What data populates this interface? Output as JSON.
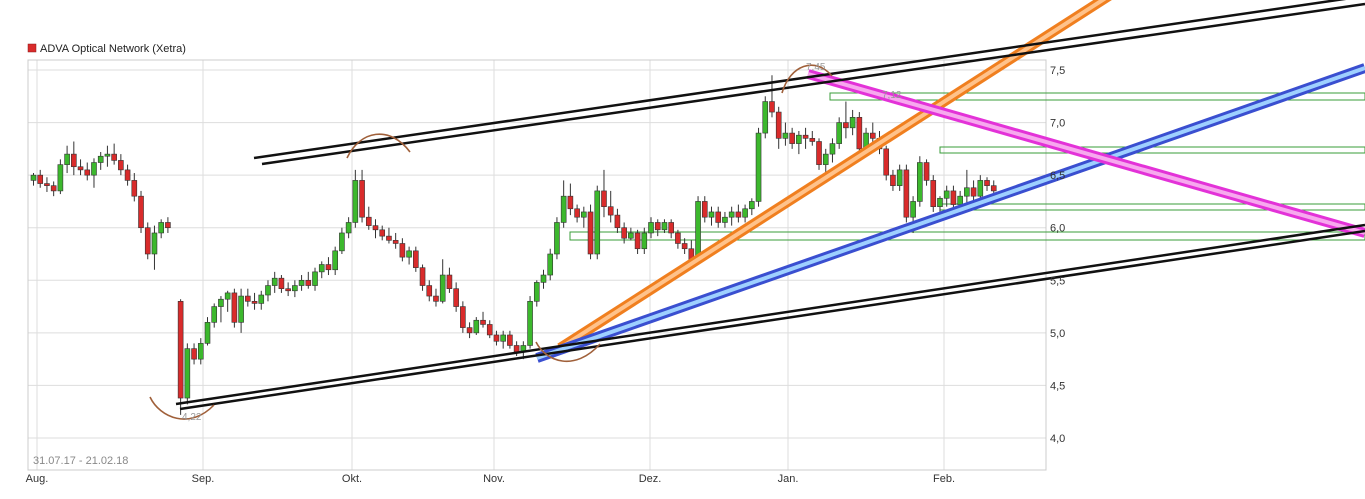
{
  "chart_data": {
    "type": "candlestick",
    "legend": {
      "label": "ADVA Optical Network (Xetra)",
      "color": "#d92b2b"
    },
    "date_range": "31.07.17 - 21.02.18",
    "y_ticks": [
      "4,0",
      "4,5",
      "5,0",
      "5,5",
      "6,0",
      "6,5",
      "7,0",
      "7,5"
    ],
    "x_ticks": [
      "Aug.",
      "Sep.",
      "Okt.",
      "Nov.",
      "Dez.",
      "Jan.",
      "Feb."
    ],
    "annotations": {
      "high": "7,45",
      "mid_high": "7,12",
      "low": "4,22"
    },
    "ylim": [
      3.8,
      7.7
    ],
    "grid": true,
    "legend_position": "top-left",
    "colors": {
      "up": "#3cb82d",
      "down": "#d92b2b",
      "grid": "#dddddd"
    },
    "candles": [
      [
        6.45,
        6.52,
        6.4,
        6.5
      ],
      [
        6.5,
        6.55,
        6.38,
        6.42
      ],
      [
        6.42,
        6.48,
        6.34,
        6.4
      ],
      [
        6.4,
        6.44,
        6.3,
        6.35
      ],
      [
        6.35,
        6.65,
        6.32,
        6.6
      ],
      [
        6.6,
        6.78,
        6.52,
        6.7
      ],
      [
        6.7,
        6.82,
        6.5,
        6.58
      ],
      [
        6.58,
        6.65,
        6.5,
        6.55
      ],
      [
        6.55,
        6.62,
        6.45,
        6.5
      ],
      [
        6.5,
        6.66,
        6.38,
        6.62
      ],
      [
        6.62,
        6.72,
        6.55,
        6.68
      ],
      [
        6.68,
        6.78,
        6.58,
        6.7
      ],
      [
        6.7,
        6.8,
        6.6,
        6.64
      ],
      [
        6.64,
        6.7,
        6.5,
        6.55
      ],
      [
        6.55,
        6.6,
        6.4,
        6.45
      ],
      [
        6.45,
        6.52,
        6.25,
        6.3
      ],
      [
        6.3,
        6.35,
        5.95,
        6.0
      ],
      [
        6.0,
        6.05,
        5.7,
        5.75
      ],
      [
        5.75,
        6.02,
        5.6,
        5.95
      ],
      [
        5.95,
        6.08,
        5.9,
        6.05
      ],
      [
        6.05,
        6.1,
        5.95,
        6.0
      ],
      [
        5.3,
        5.32,
        4.22,
        4.38
      ],
      [
        4.38,
        4.9,
        4.32,
        4.85
      ],
      [
        4.85,
        4.9,
        4.7,
        4.75
      ],
      [
        4.75,
        4.95,
        4.7,
        4.9
      ],
      [
        4.9,
        5.15,
        4.88,
        5.1
      ],
      [
        5.1,
        5.28,
        5.05,
        5.25
      ],
      [
        5.25,
        5.35,
        5.1,
        5.32
      ],
      [
        5.32,
        5.4,
        5.2,
        5.38
      ],
      [
        5.38,
        5.42,
        5.05,
        5.1
      ],
      [
        5.1,
        5.42,
        5.0,
        5.35
      ],
      [
        5.35,
        5.42,
        5.25,
        5.3
      ],
      [
        5.3,
        5.38,
        5.22,
        5.28
      ],
      [
        5.28,
        5.4,
        5.22,
        5.36
      ],
      [
        5.36,
        5.5,
        5.3,
        5.45
      ],
      [
        5.45,
        5.58,
        5.38,
        5.52
      ],
      [
        5.52,
        5.55,
        5.38,
        5.42
      ],
      [
        5.42,
        5.48,
        5.35,
        5.4
      ],
      [
        5.4,
        5.5,
        5.34,
        5.45
      ],
      [
        5.45,
        5.55,
        5.4,
        5.5
      ],
      [
        5.5,
        5.58,
        5.42,
        5.45
      ],
      [
        5.45,
        5.62,
        5.4,
        5.58
      ],
      [
        5.58,
        5.68,
        5.52,
        5.65
      ],
      [
        5.65,
        5.72,
        5.55,
        5.6
      ],
      [
        5.6,
        5.82,
        5.55,
        5.78
      ],
      [
        5.78,
        6.0,
        5.75,
        5.95
      ],
      [
        5.95,
        6.1,
        5.9,
        6.05
      ],
      [
        6.05,
        6.55,
        6.0,
        6.45
      ],
      [
        6.45,
        6.55,
        6.05,
        6.1
      ],
      [
        6.1,
        6.2,
        5.98,
        6.02
      ],
      [
        6.02,
        6.08,
        5.9,
        5.98
      ],
      [
        5.98,
        6.02,
        5.88,
        5.92
      ],
      [
        5.92,
        6.0,
        5.85,
        5.88
      ],
      [
        5.88,
        5.95,
        5.8,
        5.85
      ],
      [
        5.85,
        5.9,
        5.68,
        5.72
      ],
      [
        5.72,
        5.82,
        5.65,
        5.78
      ],
      [
        5.78,
        5.82,
        5.58,
        5.62
      ],
      [
        5.62,
        5.65,
        5.4,
        5.45
      ],
      [
        5.45,
        5.5,
        5.3,
        5.35
      ],
      [
        5.35,
        5.42,
        5.25,
        5.3
      ],
      [
        5.3,
        5.7,
        5.28,
        5.55
      ],
      [
        5.55,
        5.62,
        5.38,
        5.42
      ],
      [
        5.42,
        5.48,
        5.2,
        5.25
      ],
      [
        5.25,
        5.3,
        5.0,
        5.05
      ],
      [
        5.05,
        5.1,
        4.95,
        5.0
      ],
      [
        5.0,
        5.15,
        4.98,
        5.12
      ],
      [
        5.12,
        5.2,
        5.05,
        5.08
      ],
      [
        5.08,
        5.12,
        4.95,
        4.98
      ],
      [
        4.98,
        5.02,
        4.88,
        4.92
      ],
      [
        4.92,
        5.02,
        4.85,
        4.98
      ],
      [
        4.98,
        5.02,
        4.85,
        4.88
      ],
      [
        4.88,
        4.92,
        4.78,
        4.82
      ],
      [
        4.82,
        4.92,
        4.75,
        4.88
      ],
      [
        4.88,
        5.35,
        4.85,
        5.3
      ],
      [
        5.3,
        5.5,
        5.25,
        5.48
      ],
      [
        5.48,
        5.6,
        5.42,
        5.55
      ],
      [
        5.55,
        5.8,
        5.5,
        5.75
      ],
      [
        5.75,
        6.1,
        5.7,
        6.05
      ],
      [
        6.05,
        6.45,
        6.0,
        6.3
      ],
      [
        6.3,
        6.42,
        6.12,
        6.18
      ],
      [
        6.18,
        6.22,
        6.05,
        6.1
      ],
      [
        6.1,
        6.2,
        6.0,
        6.15
      ],
      [
        6.15,
        6.22,
        5.7,
        5.75
      ],
      [
        5.75,
        6.4,
        5.7,
        6.35
      ],
      [
        6.35,
        6.55,
        6.1,
        6.2
      ],
      [
        6.2,
        6.35,
        6.05,
        6.12
      ],
      [
        6.12,
        6.18,
        5.95,
        6.0
      ],
      [
        6.0,
        6.05,
        5.85,
        5.9
      ],
      [
        5.9,
        6.0,
        5.88,
        5.95
      ],
      [
        5.95,
        5.98,
        5.75,
        5.8
      ],
      [
        5.8,
        6.0,
        5.75,
        5.95
      ],
      [
        5.95,
        6.1,
        5.9,
        6.05
      ],
      [
        6.05,
        6.08,
        5.92,
        5.98
      ],
      [
        5.98,
        6.08,
        5.95,
        6.05
      ],
      [
        6.05,
        6.08,
        5.9,
        5.95
      ],
      [
        5.95,
        5.98,
        5.8,
        5.85
      ],
      [
        5.85,
        5.9,
        5.75,
        5.8
      ],
      [
        5.8,
        5.88,
        5.65,
        5.7
      ],
      [
        5.7,
        6.3,
        5.68,
        6.25
      ],
      [
        6.25,
        6.3,
        6.05,
        6.1
      ],
      [
        6.1,
        6.2,
        6.02,
        6.15
      ],
      [
        6.15,
        6.2,
        6.0,
        6.05
      ],
      [
        6.05,
        6.15,
        6.0,
        6.1
      ],
      [
        6.1,
        6.2,
        6.02,
        6.15
      ],
      [
        6.15,
        6.22,
        6.05,
        6.1
      ],
      [
        6.1,
        6.22,
        6.05,
        6.18
      ],
      [
        6.18,
        6.28,
        6.12,
        6.25
      ],
      [
        6.25,
        6.95,
        6.2,
        6.9
      ],
      [
        6.9,
        7.25,
        6.85,
        7.2
      ],
      [
        7.2,
        7.45,
        7.05,
        7.1
      ],
      [
        7.1,
        7.15,
        6.75,
        6.85
      ],
      [
        6.85,
        7.0,
        6.78,
        6.9
      ],
      [
        6.9,
        6.95,
        6.75,
        6.8
      ],
      [
        6.8,
        6.92,
        6.7,
        6.88
      ],
      [
        6.88,
        6.95,
        6.75,
        6.85
      ],
      [
        6.85,
        6.92,
        6.78,
        6.82
      ],
      [
        6.82,
        6.85,
        6.55,
        6.6
      ],
      [
        6.6,
        6.75,
        6.52,
        6.7
      ],
      [
        6.7,
        6.85,
        6.62,
        6.8
      ],
      [
        6.8,
        7.05,
        6.75,
        7.0
      ],
      [
        7.0,
        7.2,
        6.85,
        6.95
      ],
      [
        6.95,
        7.12,
        6.88,
        7.05
      ],
      [
        7.05,
        7.1,
        6.7,
        6.75
      ],
      [
        6.75,
        6.95,
        6.7,
        6.9
      ],
      [
        6.9,
        7.0,
        6.8,
        6.85
      ],
      [
        6.85,
        6.92,
        6.7,
        6.75
      ],
      [
        6.75,
        6.78,
        6.45,
        6.5
      ],
      [
        6.5,
        6.55,
        6.35,
        6.4
      ],
      [
        6.4,
        6.6,
        6.35,
        6.55
      ],
      [
        6.55,
        6.6,
        6.05,
        6.1
      ],
      [
        6.1,
        6.3,
        5.95,
        6.25
      ],
      [
        6.25,
        6.68,
        6.2,
        6.62
      ],
      [
        6.62,
        6.65,
        6.4,
        6.45
      ],
      [
        6.45,
        6.5,
        6.15,
        6.2
      ],
      [
        6.2,
        6.3,
        6.1,
        6.28
      ],
      [
        6.28,
        6.4,
        6.2,
        6.35
      ],
      [
        6.35,
        6.4,
        6.18,
        6.22
      ],
      [
        6.22,
        6.35,
        6.15,
        6.3
      ],
      [
        6.3,
        6.55,
        6.2,
        6.38
      ],
      [
        6.38,
        6.45,
        6.25,
        6.3
      ],
      [
        6.3,
        6.5,
        6.25,
        6.45
      ],
      [
        6.45,
        6.48,
        6.35,
        6.4
      ],
      [
        6.4,
        6.45,
        6.3,
        6.35
      ]
    ]
  }
}
